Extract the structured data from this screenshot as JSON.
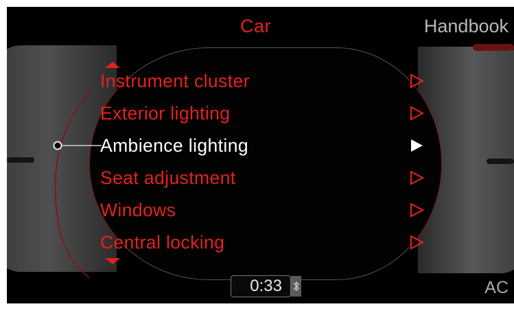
{
  "header": {
    "title": "Car",
    "right_label": "Handbook"
  },
  "menu": {
    "items": [
      {
        "label": "Instrument cluster",
        "active": false
      },
      {
        "label": "Exterior lighting",
        "active": false
      },
      {
        "label": "Ambience lighting",
        "active": true
      },
      {
        "label": "Seat adjustment",
        "active": false
      },
      {
        "label": "Windows",
        "active": false
      },
      {
        "label": "Central locking",
        "active": false
      }
    ]
  },
  "status": {
    "time": "0:33",
    "bluetooth_icon": "bluetooth-icon",
    "ac_label": "AC"
  },
  "colors": {
    "accent": "#e4221e",
    "active": "#ffffff",
    "background": "#000000"
  }
}
